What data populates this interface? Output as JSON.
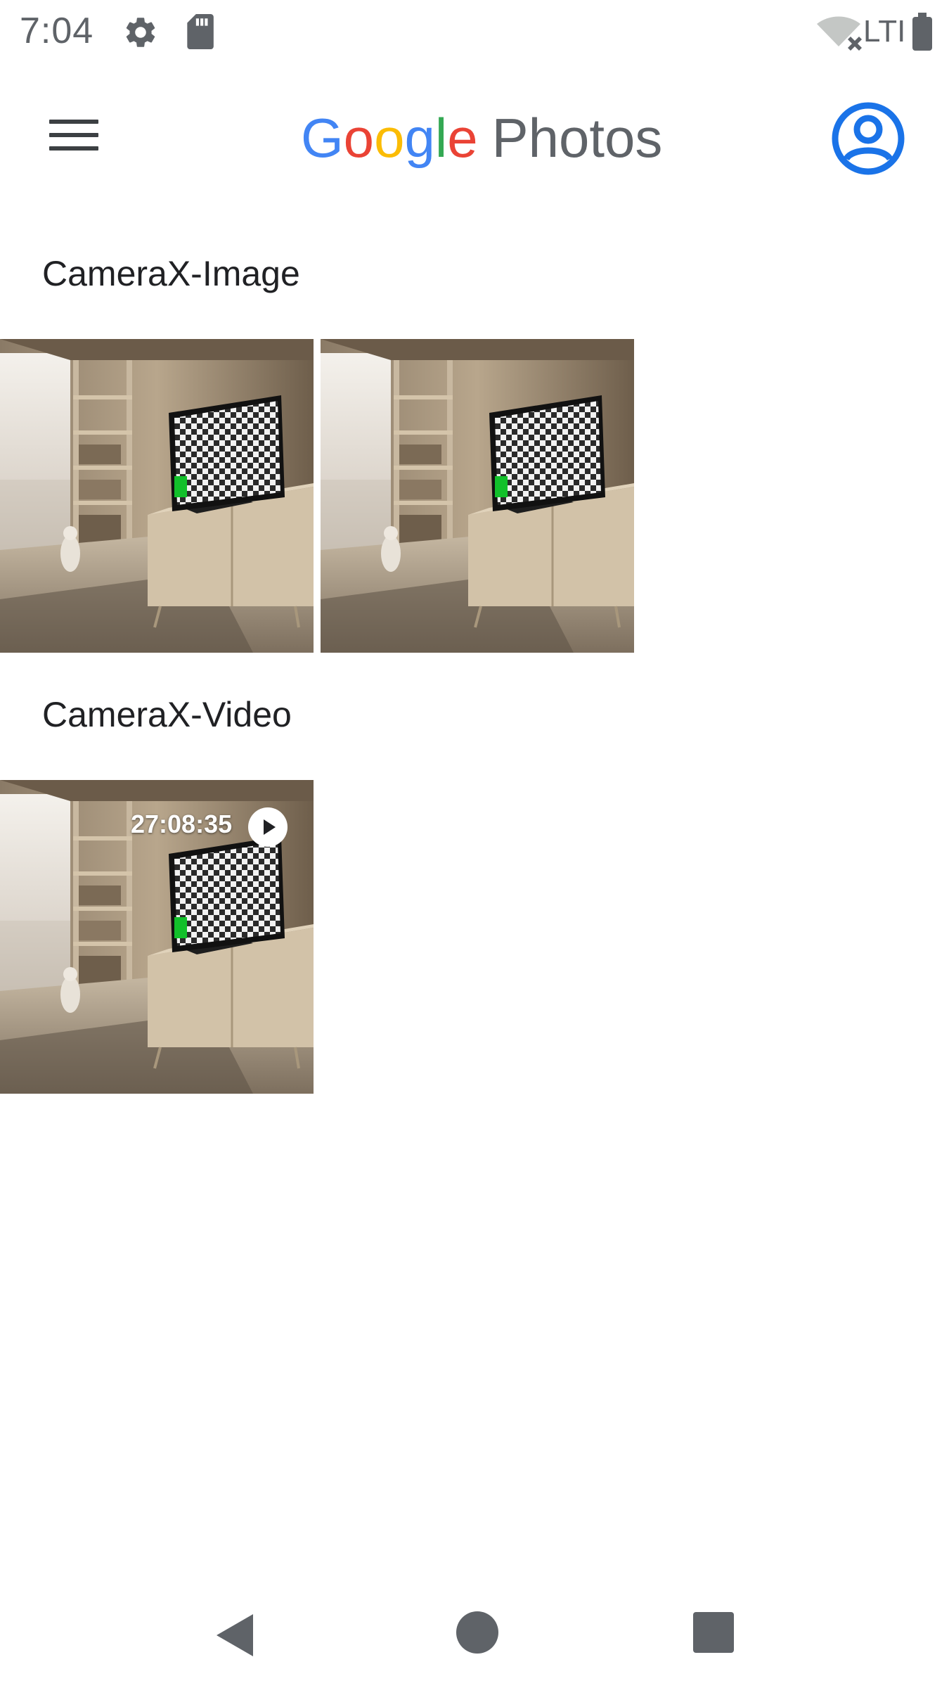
{
  "status_bar": {
    "time": "7:04",
    "network_label": "LTI",
    "icons": [
      "gear-icon",
      "sd-card-icon",
      "wifi-off-icon",
      "battery-icon"
    ]
  },
  "app_bar": {
    "logo_google_letters": [
      "G",
      "o",
      "o",
      "g",
      "l",
      "e"
    ],
    "logo_google_colors": [
      "#4285F4",
      "#EA4335",
      "#FBBC05",
      "#4285F4",
      "#34A853",
      "#EA4335"
    ],
    "logo_photos": "Photos",
    "menu_icon": "hamburger-menu-icon",
    "account_icon": "account-circle-icon",
    "accent_color": "#1A73E8"
  },
  "sections": [
    {
      "title": "CameraX-Image",
      "items": [
        {
          "type": "image"
        },
        {
          "type": "image"
        }
      ]
    },
    {
      "title": "CameraX-Video",
      "items": [
        {
          "type": "video",
          "duration": "27:08:35",
          "badge_icon": "play-icon"
        }
      ]
    }
  ],
  "nav_bar": {
    "icons": [
      "back-triangle-icon",
      "home-circle-icon",
      "recents-square-icon"
    ]
  }
}
